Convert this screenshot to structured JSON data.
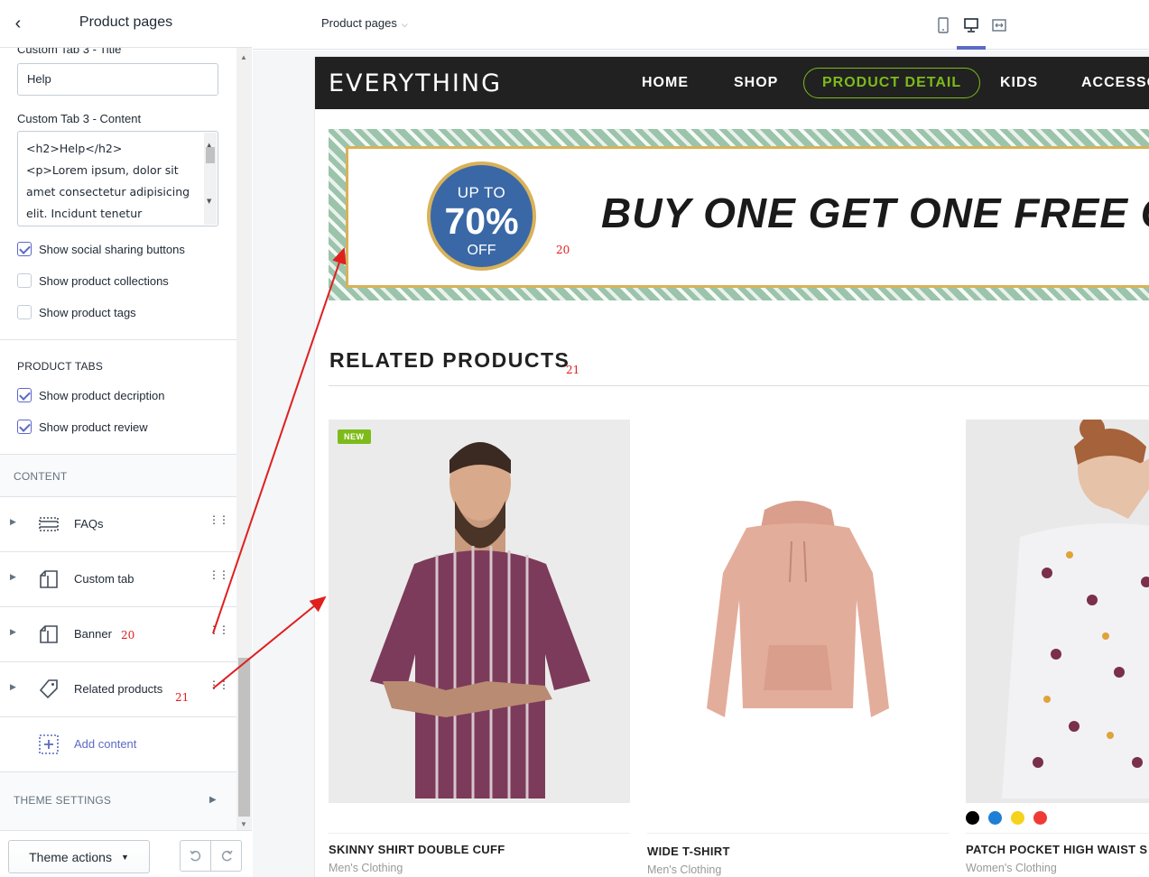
{
  "sidebar": {
    "title": "Product pages",
    "field_tab3_title_label": "Custom Tab 3 - Title",
    "field_tab3_title_value": "Help",
    "field_tab3_content_label": "Custom Tab 3 - Content",
    "field_tab3_content_lines": [
      "<h2>Help</h2>",
      "<p>Lorem ipsum, dolor sit",
      "amet consectetur adipisicing",
      "elit. Incidunt tenetur"
    ],
    "checks_top": [
      {
        "label": "Show social sharing buttons",
        "checked": true
      },
      {
        "label": "Show product collections",
        "checked": false
      },
      {
        "label": "Show product tags",
        "checked": false
      }
    ],
    "product_tabs_heading": "PRODUCT TABS",
    "checks_tabs": [
      {
        "label": "Show product decription",
        "checked": true
      },
      {
        "label": "Show product review",
        "checked": true
      }
    ],
    "content_heading": "CONTENT",
    "content_items": [
      {
        "label": "FAQs",
        "icon": "section-icon",
        "annotation": ""
      },
      {
        "label": "Custom tab",
        "icon": "layout-icon",
        "annotation": ""
      },
      {
        "label": "Banner",
        "icon": "layout-icon",
        "annotation": "20"
      },
      {
        "label": "Related products",
        "icon": "tag-icon",
        "annotation": "21"
      }
    ],
    "add_content_label": "Add content",
    "theme_settings_label": "THEME SETTINGS",
    "theme_actions_label": "Theme actions"
  },
  "topbar": {
    "page_select": "Product pages",
    "devices": [
      "mobile-icon",
      "desktop-icon",
      "fullwidth-icon"
    ],
    "active_device": "desktop-icon"
  },
  "store": {
    "logo": "EVERYTHING",
    "nav": [
      {
        "label": "HOME",
        "active": false
      },
      {
        "label": "SHOP",
        "active": false
      },
      {
        "label": "PRODUCT DETAIL",
        "active": true
      },
      {
        "label": "KIDS",
        "active": false
      },
      {
        "label": "ACCESSO",
        "active": false
      }
    ],
    "accent": "#7dbb1a",
    "banner": {
      "badge_line1": "UP TO",
      "badge_line2": "70%",
      "badge_line3": "OFF",
      "headline": "BUY ONE GET ONE FREE OF",
      "annotation": "20"
    },
    "related_title": "RELATED PRODUCTS",
    "related_annotation": "21",
    "products": [
      {
        "name": "SKINNY SHIRT DOUBLE CUFF",
        "category": "Men's Clothing",
        "tag": "NEW",
        "swatches": []
      },
      {
        "name": "WIDE T-SHIRT",
        "category": "Men's Clothing",
        "tag": "",
        "swatches": []
      },
      {
        "name": "PATCH POCKET HIGH WAIST S",
        "category": "Women's Clothing",
        "tag": "",
        "swatches": [
          "#000000",
          "#1e7fd6",
          "#f5d21c",
          "#ef3b36"
        ]
      }
    ]
  }
}
